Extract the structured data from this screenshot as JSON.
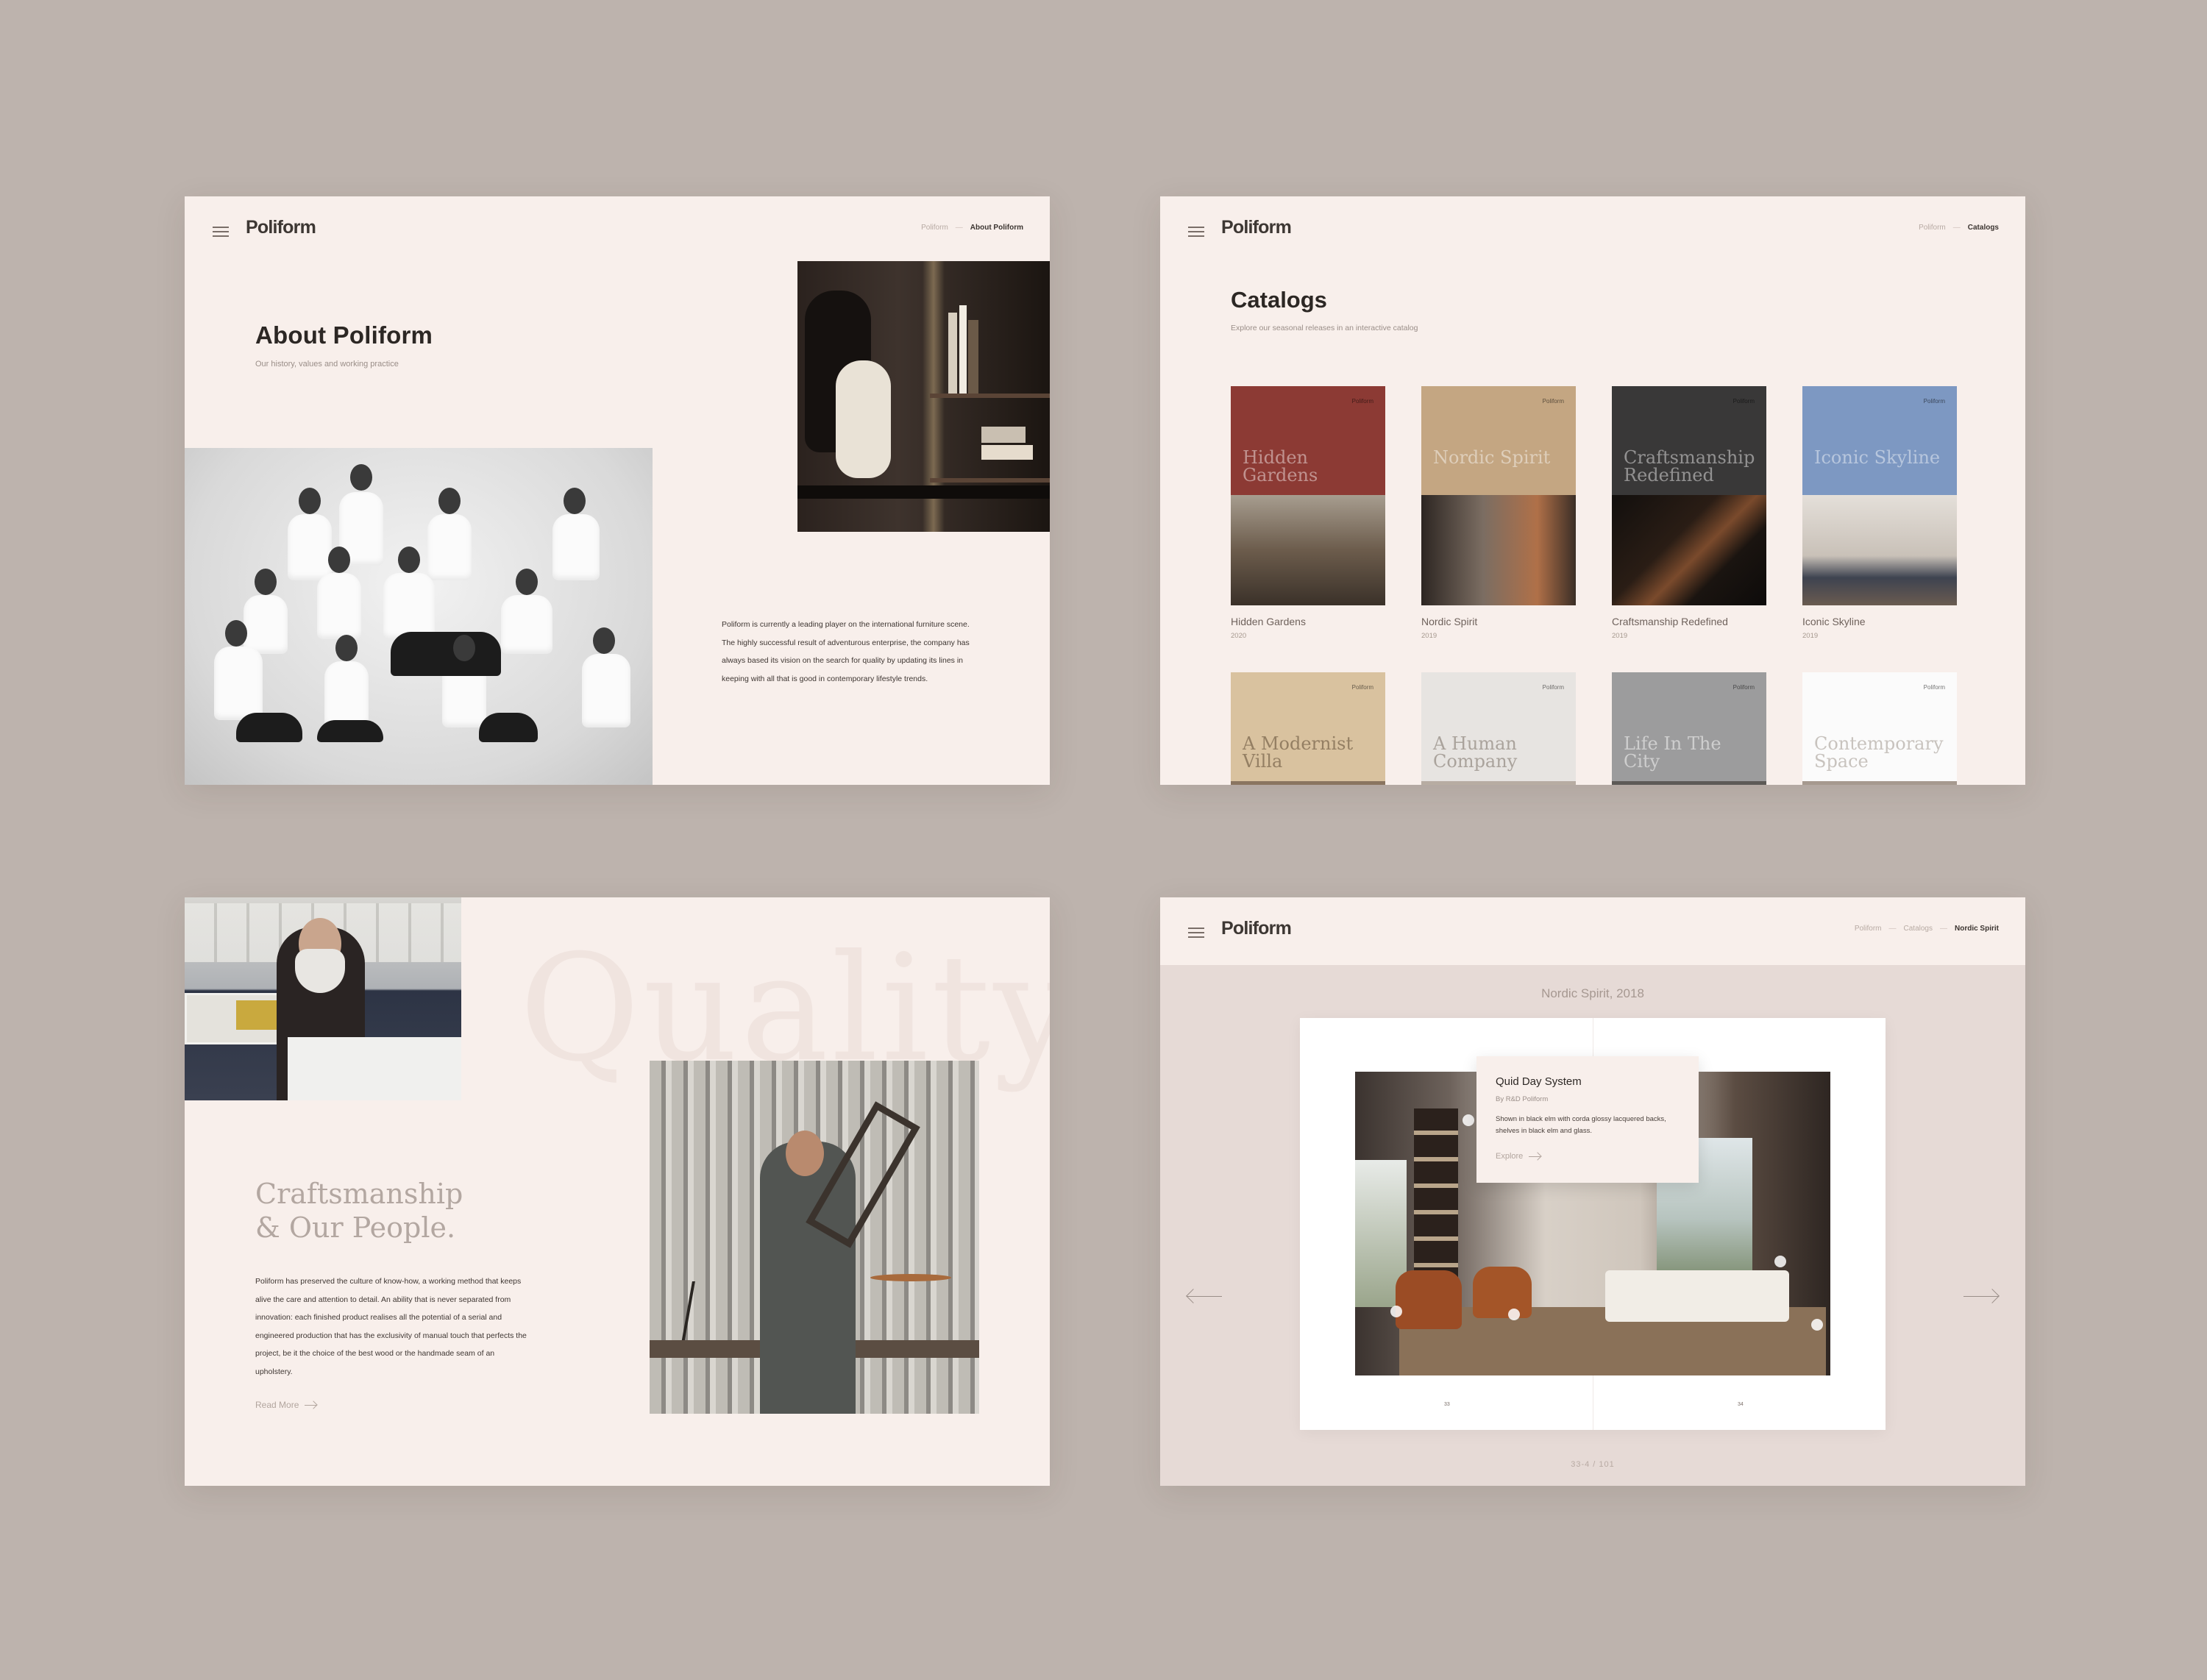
{
  "brand": {
    "logo": "Poliform"
  },
  "about": {
    "crumbs": {
      "root": "Poliform",
      "current": "About Poliform"
    },
    "title": "About Poliform",
    "subtitle": "Our history, values and working practice",
    "paragraph": "Poliform is currently a leading player on the international furniture scene. The highly successful result of adventurous enterprise, the company has always based its vision on the search for quality by updating its lines in keeping with all that is good in contemporary lifestyle trends."
  },
  "catalogs": {
    "crumbs": {
      "root": "Poliform",
      "current": "Catalogs"
    },
    "title": "Catalogs",
    "subtitle": "Explore our seasonal releases in an interactive catalog",
    "items": [
      {
        "cover_title": "Hidden Gardens",
        "name": "Hidden Gardens",
        "year": "2020",
        "color": "#8c3a34",
        "brand": "Poliform"
      },
      {
        "cover_title": "Nordic Spirit",
        "name": "Nordic Spirit",
        "year": "2019",
        "color": "#c4a682",
        "brand": "Poliform"
      },
      {
        "cover_title": "Craftsmanship Redefined",
        "name": "Craftsmanship Redefined",
        "year": "2019",
        "color": "#393838",
        "brand": "Poliform"
      },
      {
        "cover_title": "Iconic Skyline",
        "name": "Iconic Skyline",
        "year": "2019",
        "color": "#7d98c2",
        "brand": "Poliform"
      },
      {
        "cover_title": "A Modernist Villa",
        "name": "",
        "year": "",
        "color": "#d9c29f",
        "brand": "Poliform"
      },
      {
        "cover_title": "A Human Company",
        "name": "",
        "year": "",
        "color": "#e7e4e1",
        "brand": "Poliform"
      },
      {
        "cover_title": "Life In The City",
        "name": "",
        "year": "",
        "color": "#9c9c9d",
        "brand": "Poliform"
      },
      {
        "cover_title": "Contemporary Space",
        "name": "",
        "year": "",
        "color": "#fbfbfb",
        "brand": "Poliform"
      }
    ]
  },
  "craft": {
    "watermark": "Quality",
    "heading_line1": "Craftsmanship",
    "heading_line2": "& Our People.",
    "paragraph": "Poliform has preserved the culture of know-how, a working method that keeps alive the care and attention to detail. An ability that is never separated from innovation: each finished product realises all the potential of a serial and engineered production that has the exclusivity of manual touch that perfects the project, be it the choice of the best wood or the handmade seam of an upholstery.",
    "read_more": "Read More"
  },
  "viewer": {
    "crumbs": {
      "root": "Poliform",
      "middle": "Catalogs",
      "current": "Nordic Spirit"
    },
    "title": "Nordic Spirit, 2018",
    "tooltip": {
      "title": "Quid Day System",
      "by": "By R&D Poliform",
      "description": "Shown in black elm with corda glossy lacquered backs, shelves in black elm and glass.",
      "explore": "Explore"
    },
    "page_left": "33",
    "page_right": "34",
    "page_count": "33-4 / 101"
  },
  "icons": {
    "menu": "hamburger-icon",
    "arrow": "arrow-right-icon",
    "prev": "arrow-left-icon",
    "next": "arrow-right-icon"
  }
}
